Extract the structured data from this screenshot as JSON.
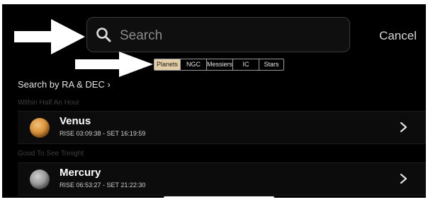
{
  "search": {
    "placeholder": "Search",
    "value": ""
  },
  "cancel_label": "Cancel",
  "scope_tabs": [
    {
      "label": "Planets",
      "selected": true
    },
    {
      "label": "NGC",
      "selected": false
    },
    {
      "label": "Messiers",
      "selected": false
    },
    {
      "label": "IC",
      "selected": false
    },
    {
      "label": "Stars",
      "selected": false
    }
  ],
  "ra_dec_label": "Search by RA & DEC ›",
  "sections": [
    {
      "header": "Within Half An Hour",
      "items": [
        {
          "name": "Venus",
          "times": "RISE 03:09:38 - SET 16:19:59",
          "icon": "venus-icon",
          "color": "#d9923a"
        }
      ]
    },
    {
      "header": "Good To See Tonight",
      "items": [
        {
          "name": "Mercury",
          "times": "RISE 06:53:27 - SET 21:22:30",
          "icon": "mercury-icon",
          "color": "#9a9a9a"
        }
      ]
    }
  ],
  "colors": {
    "accent_tab": "#e3cfa7",
    "background": "#000000"
  }
}
